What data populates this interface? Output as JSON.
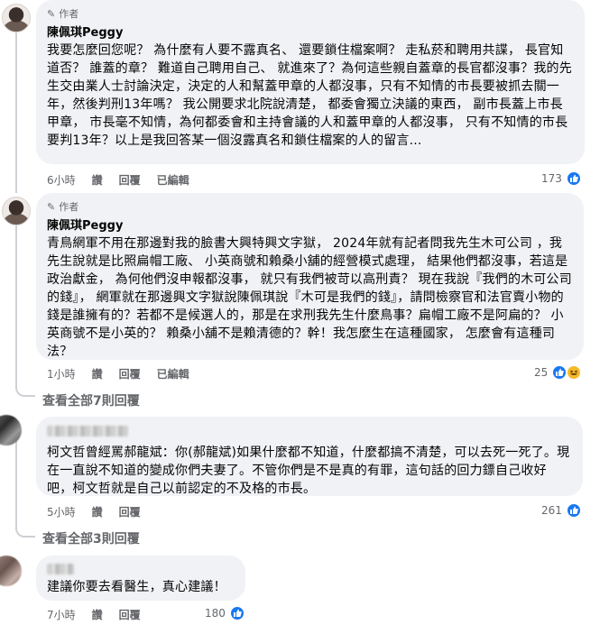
{
  "comments": [
    {
      "badge": "作者",
      "author": "陳佩琪Peggy",
      "text": "我要怎麼回您呢？ 為什麼有人要不露真名、 還要鎖住檔案啊？ 走私菸和聘用共諜， 長官知道否？ 誰蓋的章？ 難道自己聘用自己、 就進來了？為何這些親自蓋章的長官都沒事？我的先生交由業人士討論決定，決定的人和幫蓋甲章的人都沒事，只有不知情的市長要被抓去關一年，然後判刑13年嗎？ 我公開要求北院說清楚， 都委會獨立決議的東西， 副市長蓋上市長甲章， 市長毫不知情，為何都委會和主持會議的人和蓋甲章的人都沒事， 只有不知情的市長要判13年？以上是我回答某一個沒露真名和鎖住檔案的人的留言...",
      "time": "6小時",
      "like_label": "讚",
      "reply_label": "回覆",
      "edited_label": "已編輯",
      "reaction_count": "173"
    },
    {
      "badge": "作者",
      "author": "陳佩琪Peggy",
      "text": "青鳥網軍不用在那邊對我的臉書大興特興文字獄， 2024年就有記者問我先生木可公司 ，我先生說就是比照扁帽工廠、 小英商號和賴桑小舖的經營模式處理， 結果他們都沒事，若這是政治獻金， 為何他們沒申報都沒事， 就只有我們被苛以高刑責？ 現在我說『我們的木可公司的錢』， 網軍就在那邊興文字獄說陳佩琪說『木可是我們的錢』，請問檢察官和法官賣小物的錢是誰擁有的？若都不是候選人的，那是在求刑我先生什麼鳥事？扁帽工廠不是阿扁的？ 小英商號不是小英的？ 賴桑小舖不是賴清德的？幹！我怎麼生在這種國家， 怎麼會有這種司法？",
      "time": "1小時",
      "like_label": "讚",
      "reply_label": "回覆",
      "edited_label": "已編輯",
      "reaction_count": "25"
    },
    {
      "text": "柯文哲曾經罵郝龍斌：你(郝龍斌)如果什麼都不知道，什麼都搞不清楚，可以去死一死了。現在一直說不知道的變成你們夫妻了。不管你們是不是真的有罪，這句話的回力鏢自己收好吧，柯文哲就是自己以前認定的不及格的市長。",
      "time": "5小時",
      "like_label": "讚",
      "reply_label": "回覆",
      "reaction_count": "261"
    },
    {
      "text": "建議你要去看醫生，真心建議！",
      "time": "7小時",
      "like_label": "讚",
      "reply_label": "回覆",
      "reaction_count": "180"
    }
  ],
  "view_more_1": "查看全部7則回覆",
  "view_more_2": "查看全部3則回覆",
  "colors": {
    "like_blue": "#1877f2",
    "haha_yellow": "#f7b928",
    "bubble_bg": "#f0f2f5",
    "meta_gray": "#65676b"
  },
  "icons": [
    "pencil-icon",
    "like-icon",
    "haha-icon"
  ]
}
